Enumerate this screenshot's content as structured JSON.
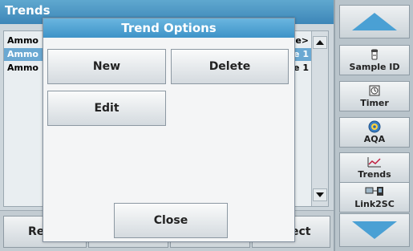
{
  "title": "Trends",
  "list": {
    "rows": [
      {
        "left": "Ammo",
        "right": "e>"
      },
      {
        "left": "Ammo",
        "right": "e 1"
      },
      {
        "left": "Ammo",
        "right": "e 1"
      }
    ]
  },
  "bottom": {
    "left_label": "Re",
    "right_label": "ect"
  },
  "sidebar": {
    "items": [
      {
        "label": "Sample ID",
        "icon": "sample-id-icon"
      },
      {
        "label": "Timer",
        "icon": "timer-icon"
      },
      {
        "label": "AQA",
        "icon": "aqa-icon"
      },
      {
        "label": "Trends",
        "icon": "trends-icon"
      },
      {
        "label": "Link2SC",
        "icon": "link2sc-icon"
      }
    ]
  },
  "dialog": {
    "title": "Trend Options",
    "new_label": "New",
    "delete_label": "Delete",
    "edit_label": "Edit",
    "close_label": "Close"
  },
  "colors": {
    "accent": "#4aa0d4",
    "title_bar": "#3d86b8",
    "selection": "#6aa8d2"
  }
}
